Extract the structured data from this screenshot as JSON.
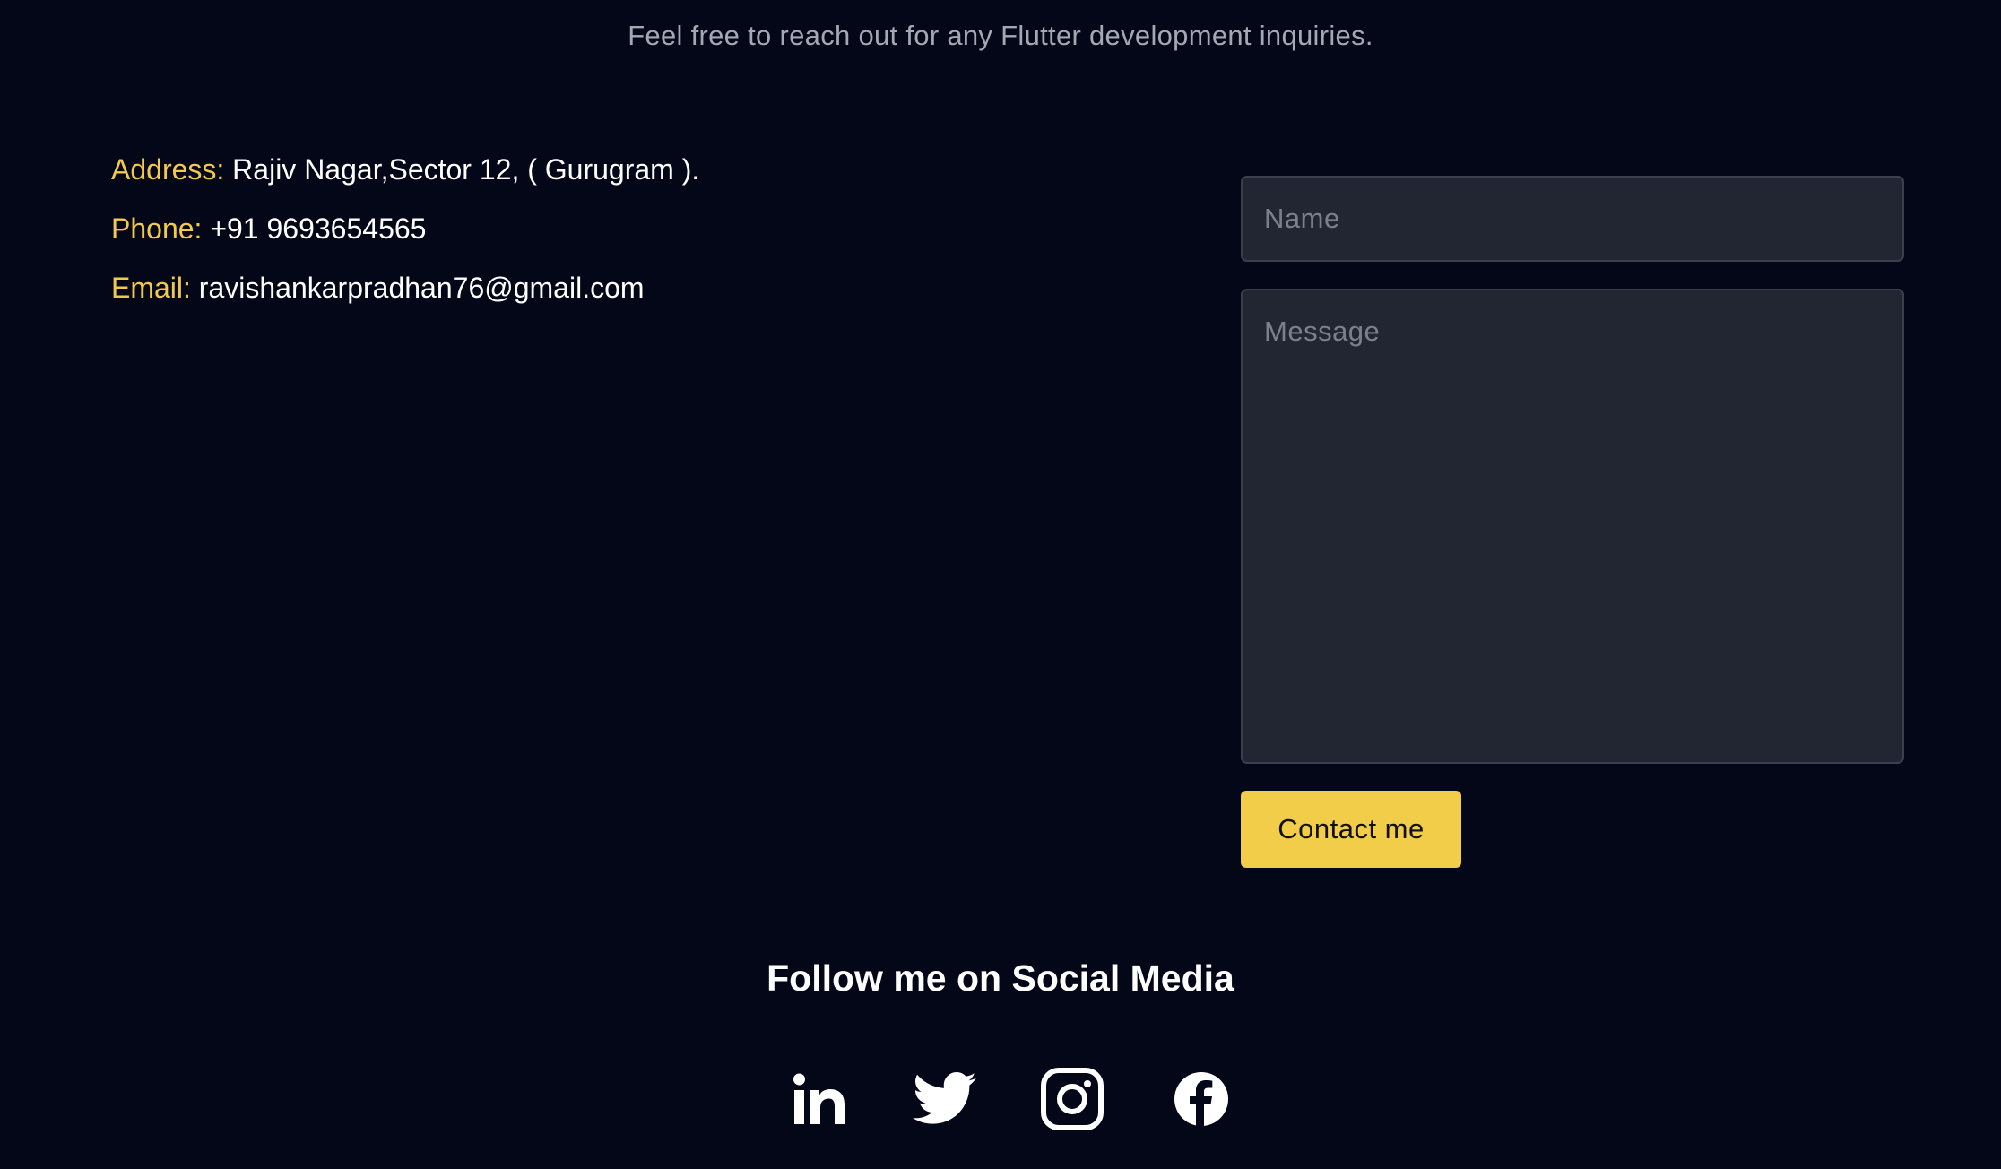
{
  "subtitle": "Feel free to reach out for any Flutter development inquiries.",
  "contact_info": {
    "address_label": "Address:",
    "address_value": "Rajiv Nagar,Sector 12, ( Gurugram ).",
    "phone_label": "Phone:",
    "phone_value": "+91 9693654565",
    "email_label": "Email:",
    "email_value": "ravishankarpradhan76@gmail.com"
  },
  "form": {
    "name_placeholder": "Name",
    "name_value": "",
    "message_placeholder": "Message",
    "message_value": "",
    "submit_label": "Contact me"
  },
  "social": {
    "title": "Follow me on Social Media",
    "icons": [
      "linkedin-icon",
      "twitter-icon",
      "instagram-icon",
      "facebook-icon"
    ]
  },
  "colors": {
    "background": "#040717",
    "accent": "#f2cd4a",
    "label": "#f2c94c",
    "field_background": "#222633",
    "muted_text": "#a3a8b3"
  }
}
